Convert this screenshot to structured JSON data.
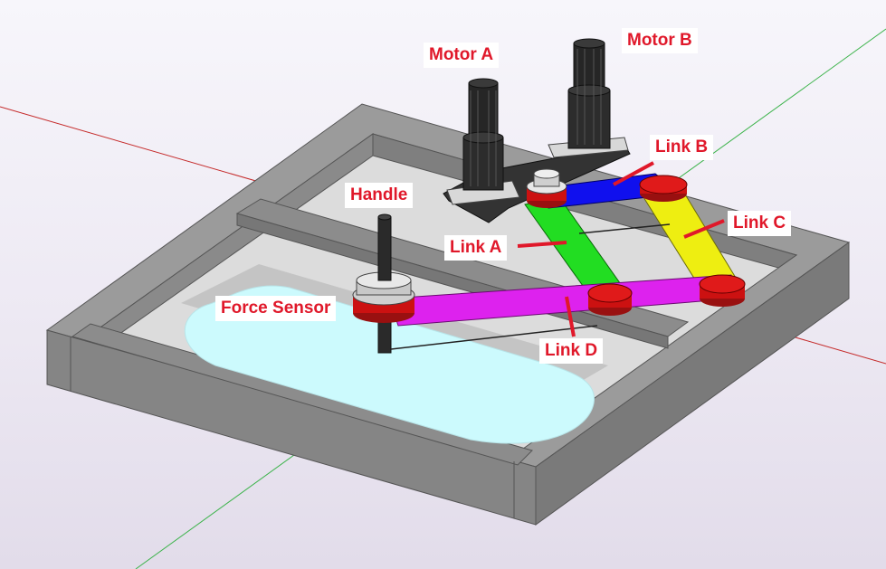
{
  "labels": {
    "motor_a": "Motor A",
    "motor_b": "Motor B",
    "link_a": "Link A",
    "link_b": "Link B",
    "link_c": "Link C",
    "link_d": "Link D",
    "handle": "Handle",
    "force_sensor": "Force Sensor"
  },
  "colors": {
    "background": "#f2f0f7",
    "frame": "#8e8e8e",
    "workspace": "#ccfafd",
    "link_a": "#22dd22",
    "link_b": "#1010ee",
    "link_c": "#eeee11",
    "link_d": "#dd22ee",
    "joint": "#cc1111",
    "motor": "#222222",
    "label_text": "#e0182a"
  }
}
